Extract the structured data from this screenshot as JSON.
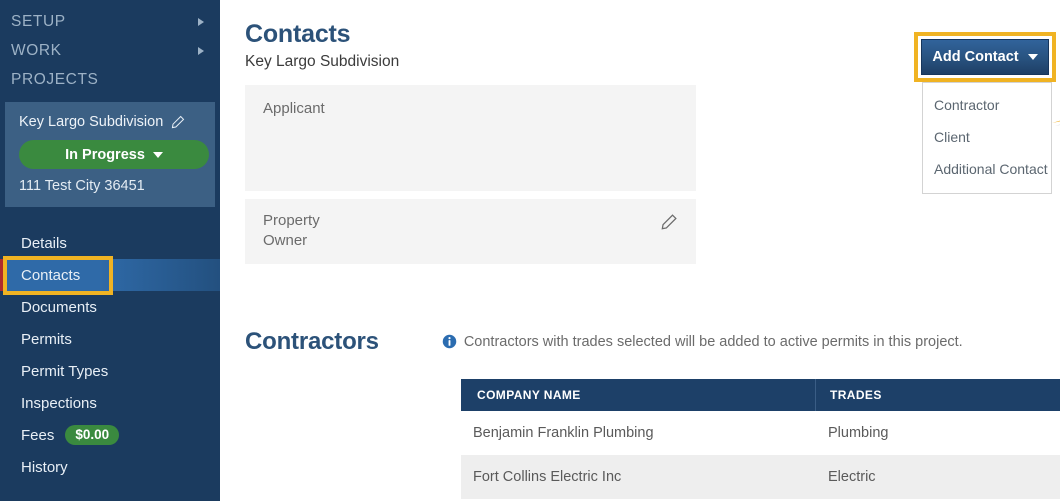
{
  "colors": {
    "sidebar_bg": "#1b3b5f",
    "sidebar_card_bg": "#3c6084",
    "accent_blue": "#2c5279",
    "status_green": "#3a8a3f",
    "highlight_yellow": "#f0b323",
    "table_header": "#1d4068",
    "selected_nav": "#2f6aa8"
  },
  "sidebar": {
    "top_nav": [
      {
        "label": "SETUP",
        "has_caret": true,
        "icon": "chevron-right-icon"
      },
      {
        "label": "WORK",
        "has_caret": true,
        "icon": "chevron-right-icon"
      },
      {
        "label": "PROJECTS",
        "has_caret": false,
        "icon": ""
      }
    ],
    "project": {
      "name": "Key Largo Subdivision",
      "edit_icon": "pencil-icon",
      "status": "In Progress",
      "status_caret_icon": "chevron-down-icon",
      "address": "111 Test City 36451"
    },
    "nav": [
      {
        "label": "Details",
        "selected": false,
        "badge": ""
      },
      {
        "label": "Contacts",
        "selected": true,
        "badge": ""
      },
      {
        "label": "Documents",
        "selected": false,
        "badge": ""
      },
      {
        "label": "Permits",
        "selected": false,
        "badge": ""
      },
      {
        "label": "Permit Types",
        "selected": false,
        "badge": ""
      },
      {
        "label": "Inspections",
        "selected": false,
        "badge": ""
      },
      {
        "label": "Fees",
        "selected": false,
        "badge": "$0.00"
      },
      {
        "label": "History",
        "selected": false,
        "badge": ""
      }
    ]
  },
  "header": {
    "title": "Contacts",
    "subtitle": "Key Largo Subdivision"
  },
  "add_contact": {
    "label": "Add Contact",
    "caret_icon": "chevron-down-icon",
    "menu": [
      {
        "label": "Contractor"
      },
      {
        "label": "Client"
      },
      {
        "label": "Additional Contact"
      }
    ]
  },
  "contact_cards": [
    {
      "line1": "Applicant",
      "line2": "",
      "has_edit": false
    },
    {
      "line1": "Property",
      "line2": "Owner",
      "has_edit": true
    }
  ],
  "contractors": {
    "title": "Contractors",
    "info_icon": "info-icon",
    "note": "Contractors with trades selected will be added to active permits in this project.",
    "columns": [
      "COMPANY NAME",
      "TRADES"
    ],
    "rows": [
      {
        "company": "Benjamin Franklin Plumbing",
        "trades": "Plumbing",
        "edit_icon": "pencil-icon",
        "delete_icon": "trash-icon"
      },
      {
        "company": "Fort Collins Electric Inc",
        "trades": "Electric",
        "edit_icon": "pencil-icon",
        "delete_icon": "trash-icon"
      }
    ]
  },
  "annotations": {
    "arrow_icon": "arrow-right-annotation",
    "highlight_boxes": [
      "add-contact-button",
      "sidebar-item-contacts"
    ]
  }
}
